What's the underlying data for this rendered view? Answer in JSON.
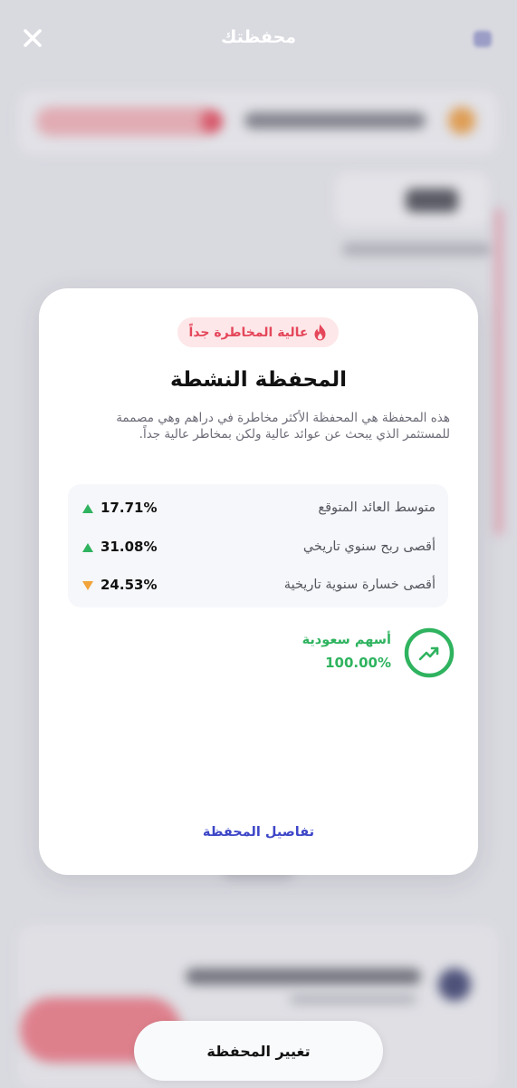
{
  "header": {
    "title": "محفظتك",
    "close_icon": "close-icon"
  },
  "modal": {
    "risk_badge": {
      "label": "عالية المخاطرة جداً",
      "icon": "fire-icon",
      "color": "#e5475a"
    },
    "title": "المحفظة النشطة",
    "description": "هذه المحفظة هي المحفظة الأكثر مخاطرة في دراهم وهي مصممة للمستثمر الذي يبحث عن عوائد عالية ولكن بمخاطر عالية جداً.",
    "stats": [
      {
        "label": "متوسط العائد المتوقع",
        "value": "17.71%",
        "trend": "up",
        "trend_color": "#2fb35f"
      },
      {
        "label": "أقصى ربح سنوي تاريخي",
        "value": "31.08%",
        "trend": "up",
        "trend_color": "#2fb35f"
      },
      {
        "label": "أقصى خسارة سنوية تاريخية",
        "value": "24.53%",
        "trend": "down",
        "trend_color": "#f2a33a"
      }
    ],
    "allocation": {
      "name": "أسهم سعودية",
      "value": "100.00%",
      "fraction": 1.0,
      "icon": "trending-up-icon",
      "color": "#2fb35f"
    },
    "details_link": "تفاصيل المحفظة"
  },
  "footer": {
    "change_button": "تغيير المحفظة"
  }
}
